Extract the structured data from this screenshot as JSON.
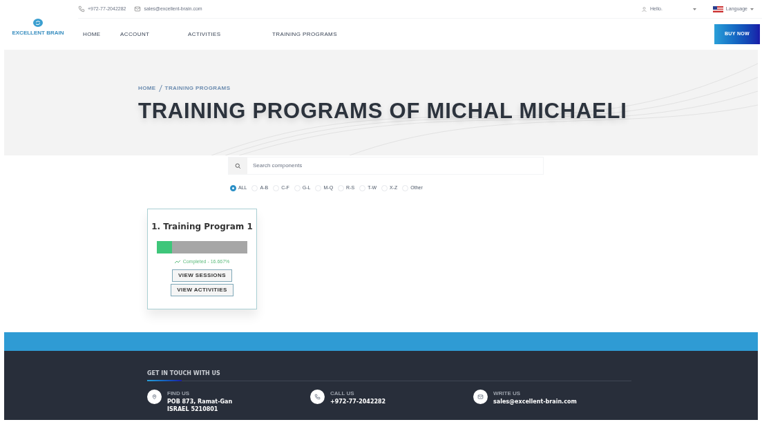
{
  "topbar": {
    "phone": "+972-77-2042282",
    "email": "sales@excellent-brain.com",
    "user": "Hello.",
    "language": "Language"
  },
  "logo": {
    "text": "EXCELLENT BRAIN"
  },
  "nav": [
    {
      "label": "HOME"
    },
    {
      "label": "ACCOUNT"
    },
    {
      "label": "ACTIVITIES"
    },
    {
      "label": "TRAINING PROGRAMS"
    }
  ],
  "buy_button": "BUY NOW",
  "breadcrumb": [
    "HOME",
    "TRAINING PROGRAMS"
  ],
  "page_title": "TRAINING PROGRAMS OF MICHAL MICHAELI",
  "search": {
    "placeholder": "Search components"
  },
  "filters": [
    {
      "label": "ALL",
      "selected": true
    },
    {
      "label": "A-B",
      "selected": false
    },
    {
      "label": "C-F",
      "selected": false
    },
    {
      "label": "G-L",
      "selected": false
    },
    {
      "label": "M-Q",
      "selected": false
    },
    {
      "label": "R-S",
      "selected": false
    },
    {
      "label": "T-W",
      "selected": false
    },
    {
      "label": "X-Z",
      "selected": false
    },
    {
      "label": "Other",
      "selected": false
    }
  ],
  "programs": [
    {
      "title": "1. Training Program 1",
      "level": 0.16667,
      "status": "Completed - 16.667%",
      "buttons": [
        "VIEW SESSIONS",
        "VIEW ACTIVITIES"
      ]
    }
  ],
  "footer": {
    "heading": "GET IN TOUCH WITH US",
    "contacts": [
      {
        "kind": "location",
        "label": "FIND US",
        "lines": [
          "POB 873, Ramat-Gan",
          "ISRAEL 5210801"
        ]
      },
      {
        "kind": "phone",
        "label": "CALL US",
        "lines": [
          "+972-77-2042282"
        ]
      },
      {
        "kind": "mail",
        "label": "WRITE US",
        "lines": [
          "sales@excellent-brain.com"
        ]
      }
    ]
  }
}
